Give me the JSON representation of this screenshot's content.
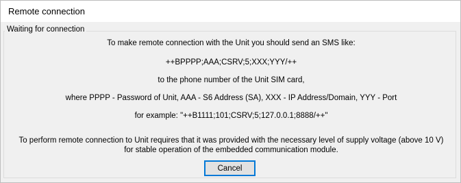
{
  "window": {
    "title": "Remote connection"
  },
  "group": {
    "label": "Waiting for connection"
  },
  "message": {
    "line1": "To make remote connection with the Unit you should send an SMS like:",
    "line2": "++BPPPP;AAA;CSRV;5;XXX;YYY/++",
    "line3": "to the phone number of the Unit SIM card,",
    "line4": "where PPPP - Password of Unit, AAA - S6 Address (SA), XXX - IP Address/Domain, YYY - Port",
    "line5": "for example: \"++B1111;101;CSRV;5;127.0.0.1;8888/++\"",
    "line6": "To perform remote connection to Unit requires that it was provided with the necessary level of supply voltage (above 10 V)",
    "line7": "for stable operation of the embedded communication module."
  },
  "buttons": {
    "cancel_label": "Cancel"
  },
  "colors": {
    "accent": "#0078d7",
    "dialog_background": "#f0f0f0"
  }
}
